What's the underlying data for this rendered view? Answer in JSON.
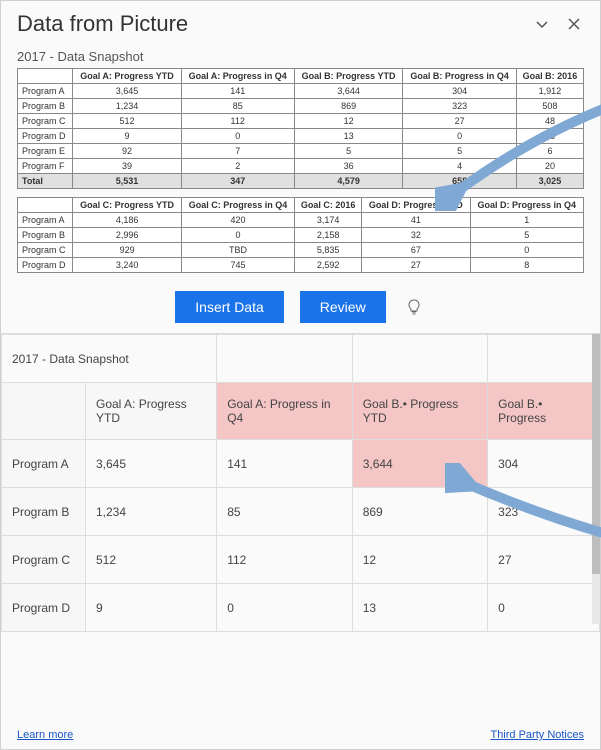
{
  "title": "Data from Picture",
  "snapshot_title": "2017 - Data Snapshot",
  "actions": {
    "insert": "Insert Data",
    "review": "Review"
  },
  "footer": {
    "learn_more": "Learn more",
    "third_party": "Third Party Notices"
  },
  "chart_data": [
    {
      "type": "table",
      "title": "2017 - Data Snapshot (upper)",
      "columns": [
        "",
        "Goal A: Progress YTD",
        "Goal A: Progress in Q4",
        "Goal B: Progress YTD",
        "Goal B: Progress in Q4",
        "Goal B: 2016"
      ],
      "rows": [
        {
          "label": "Program A",
          "values": [
            "3,645",
            "141",
            "3,644",
            "304",
            "1,912"
          ]
        },
        {
          "label": "Program B",
          "values": [
            "1,234",
            "85",
            "869",
            "323",
            "508"
          ]
        },
        {
          "label": "Program C",
          "values": [
            "512",
            "112",
            "12",
            "27",
            "48"
          ]
        },
        {
          "label": "Program D",
          "values": [
            "9",
            "0",
            "13",
            "0",
            "93"
          ]
        },
        {
          "label": "Program E",
          "values": [
            "92",
            "7",
            "5",
            "5",
            "6"
          ]
        },
        {
          "label": "Program F",
          "values": [
            "39",
            "2",
            "36",
            "4",
            "20"
          ]
        }
      ],
      "total": {
        "label": "Total",
        "values": [
          "5,531",
          "347",
          "4,579",
          "658",
          "3,025"
        ]
      }
    },
    {
      "type": "table",
      "title": "2017 - Data Snapshot (lower)",
      "columns": [
        "",
        "Goal C: Progress YTD",
        "Goal C: Progress in Q4",
        "Goal C: 2016",
        "Goal D: Progress YTD",
        "Goal D: Progress in Q4"
      ],
      "rows": [
        {
          "label": "Program A",
          "values": [
            "4,186",
            "420",
            "3,174",
            "41",
            "1"
          ]
        },
        {
          "label": "Program B",
          "values": [
            "2,996",
            "0",
            "2,158",
            "32",
            "5"
          ]
        },
        {
          "label": "Program C",
          "values": [
            "929",
            "TBD",
            "5,835",
            "67",
            "0"
          ]
        },
        {
          "label": "Program D",
          "values": [
            "3,240",
            "745",
            "2,592",
            "27",
            "8"
          ]
        }
      ]
    }
  ],
  "result_grid": {
    "title_cell": "2017 - Data Snapshot",
    "headers": [
      {
        "text": "Goal A: Progress YTD",
        "flag": false
      },
      {
        "text": "Goal A: Progress in Q4",
        "flag": true
      },
      {
        "text": "Goal B.• Progress YTD",
        "flag": true
      },
      {
        "text": "Goal B.• Progress",
        "flag": true
      }
    ],
    "rows": [
      {
        "label": "Program A",
        "cells": [
          {
            "text": "3,645",
            "flag": false
          },
          {
            "text": "141",
            "flag": false
          },
          {
            "text": "3,644",
            "flag": true
          },
          {
            "text": "304",
            "flag": false
          }
        ]
      },
      {
        "label": "Program B",
        "cells": [
          {
            "text": "1,234",
            "flag": false
          },
          {
            "text": "85",
            "flag": false
          },
          {
            "text": "869",
            "flag": false
          },
          {
            "text": "323",
            "flag": false
          }
        ]
      },
      {
        "label": "Program C",
        "cells": [
          {
            "text": "512",
            "flag": false
          },
          {
            "text": "112",
            "flag": false
          },
          {
            "text": "12",
            "flag": false
          },
          {
            "text": "27",
            "flag": false
          }
        ]
      },
      {
        "label": "Program D",
        "cells": [
          {
            "text": "9",
            "flag": false
          },
          {
            "text": "0",
            "flag": false
          },
          {
            "text": "13",
            "flag": false
          },
          {
            "text": "0",
            "flag": false
          }
        ]
      }
    ]
  }
}
